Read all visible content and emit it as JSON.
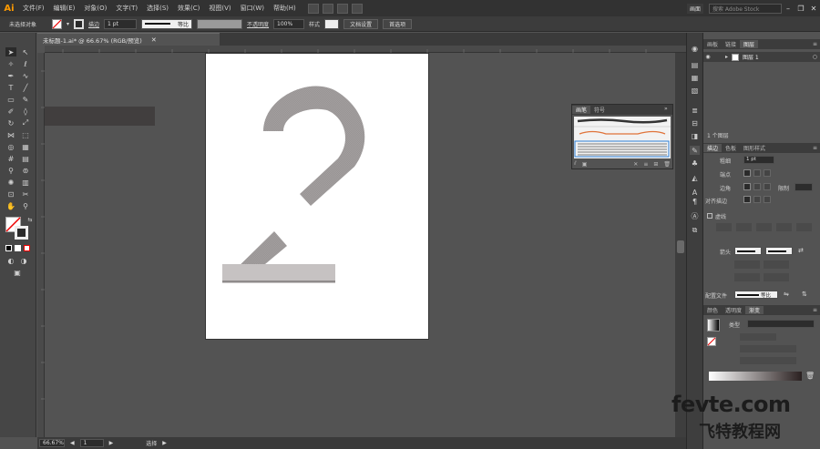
{
  "menubar": {
    "logo": "Ai",
    "items": [
      "文件(F)",
      "编辑(E)",
      "对象(O)",
      "文字(T)",
      "选择(S)",
      "效果(C)",
      "视图(V)",
      "窗口(W)",
      "帮助(H)"
    ],
    "workspace": "画面",
    "search_placeholder": "搜索 Adobe Stock"
  },
  "control": {
    "selection": "未选择对象",
    "stroke_label": "描边",
    "stroke_value": "1 pt",
    "stroke_style": "等比",
    "opacity_label": "不透明度",
    "opacity_value": "100%",
    "style_label": "样式",
    "doc_setup": "文档设置",
    "prefs": "首选项"
  },
  "document": {
    "tab_title": "未标题-1.ai* @ 66.67% (RGB/预览)",
    "zoom": "66.67%",
    "artboard": "1",
    "status": "选择"
  },
  "brush_panel": {
    "tabs": [
      "画笔",
      "符号"
    ]
  },
  "layers_panel": {
    "tabs": [
      "画板",
      "链接",
      "图层"
    ],
    "layer_name": "图层 1",
    "footer": "1 个图层"
  },
  "stroke_panel": {
    "tabs": [
      "描边",
      "色板",
      "图形样式"
    ],
    "weight_label": "粗细",
    "weight_value": "1 pt",
    "cap_label": "端点",
    "corner_label": "边角",
    "limit_label": "限制",
    "align_label": "对齐描边",
    "dashed_label": "虚线",
    "arrow_label": "箭头",
    "profile_label": "配置文件",
    "profile_value": "等比"
  },
  "gradient_panel": {
    "tabs": [
      "颜色",
      "透明度",
      "渐变"
    ],
    "type_label": "类型"
  },
  "watermark": {
    "line1": "fevte.com",
    "line2": "飞特教程网"
  }
}
